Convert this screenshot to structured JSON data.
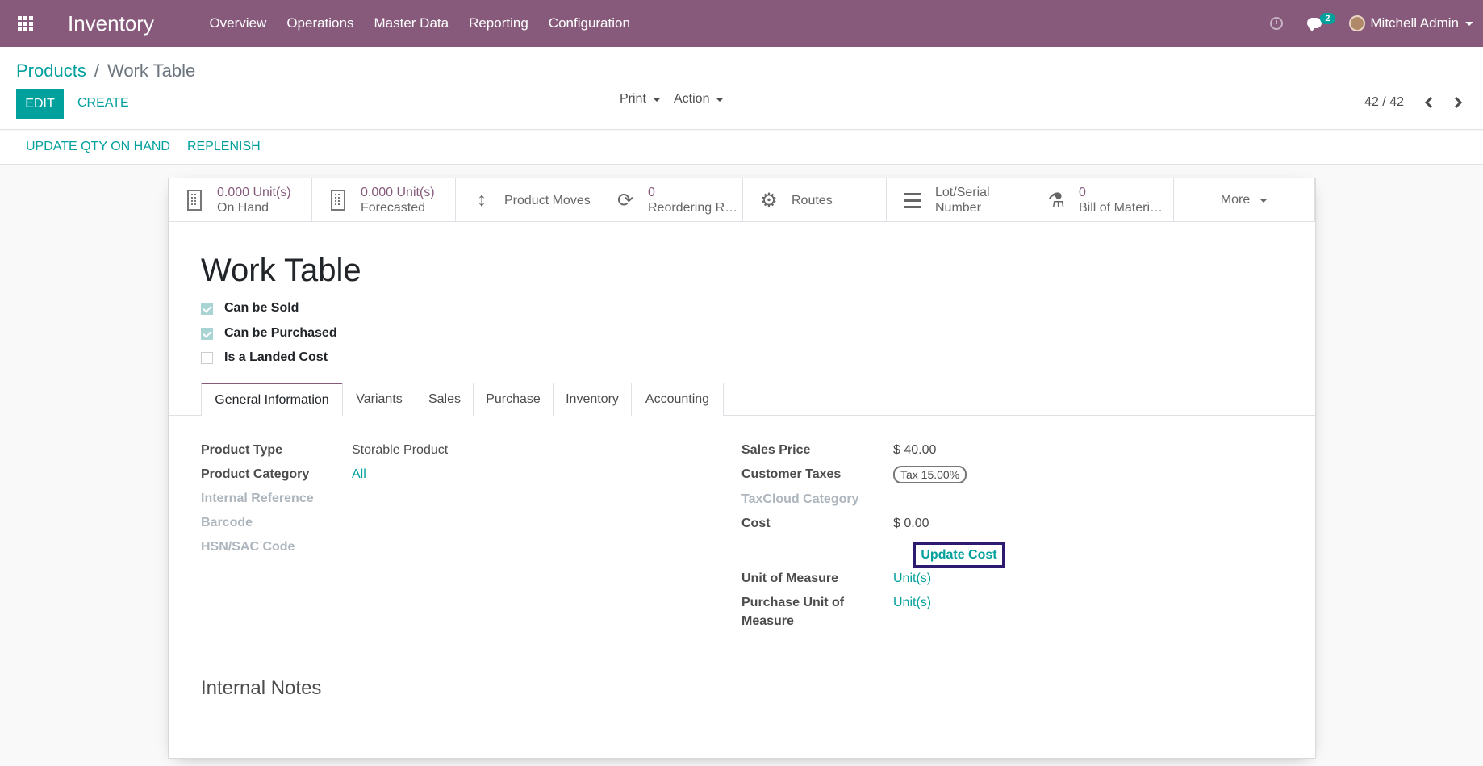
{
  "navbar": {
    "app_title": "Inventory",
    "menu": [
      "Overview",
      "Operations",
      "Master Data",
      "Reporting",
      "Configuration"
    ],
    "messages_count": "2",
    "user_name": "Mitchell Admin",
    "brand_color": "#875a7b"
  },
  "breadcrumb": {
    "parent": "Products",
    "separator": "/",
    "current": "Work Table"
  },
  "buttons": {
    "edit": "EDIT",
    "create": "CREATE",
    "print": "Print",
    "action": "Action"
  },
  "pager": {
    "value": "42 / 42"
  },
  "statusbar": {
    "update_qty": "UPDATE QTY ON HAND",
    "replenish": "REPLENISH"
  },
  "smart_buttons": [
    {
      "value": "0.000 Unit(s)",
      "label": "On Hand",
      "icon": "building-icon"
    },
    {
      "value": "0.000 Unit(s)",
      "label": "Forecasted",
      "icon": "building-icon"
    },
    {
      "value": "",
      "label": "Product Moves",
      "icon": "arrows-vertical-icon"
    },
    {
      "value": "0",
      "label": "Reordering R…",
      "icon": "refresh-icon"
    },
    {
      "value": "",
      "label": "Routes",
      "icon": "gears-icon"
    },
    {
      "value": "",
      "label": "Lot/Serial",
      "label2": "Number",
      "icon": "list-icon"
    },
    {
      "value": "0",
      "label": "Bill of Materi…",
      "icon": "flask-icon"
    }
  ],
  "more": "More",
  "product": {
    "name": "Work Table",
    "can_be_sold": "Can be Sold",
    "can_be_purchased": "Can be Purchased",
    "is_landed_cost": "Is a Landed Cost"
  },
  "tabs": [
    "General Information",
    "Variants",
    "Sales",
    "Purchase",
    "Inventory",
    "Accounting"
  ],
  "left_fields": {
    "product_type_label": "Product Type",
    "product_type_value": "Storable Product",
    "category_label": "Product Category",
    "category_value": "All",
    "internal_ref_label": "Internal Reference",
    "barcode_label": "Barcode",
    "hsn_label": "HSN/SAC Code"
  },
  "right_fields": {
    "sales_price_label": "Sales Price",
    "sales_price_value": "$ 40.00",
    "customer_taxes_label": "Customer Taxes",
    "customer_taxes_value": "Tax 15.00%",
    "taxcloud_label": "TaxCloud Category",
    "cost_label": "Cost",
    "cost_value": "$ 0.00",
    "update_cost": "Update Cost",
    "uom_label": "Unit of Measure",
    "uom_value": "Unit(s)",
    "purchase_uom_label_1": "Purchase Unit of",
    "purchase_uom_label_2": "Measure",
    "purchase_uom_value": "Unit(s)"
  },
  "internal_notes": "Internal Notes"
}
